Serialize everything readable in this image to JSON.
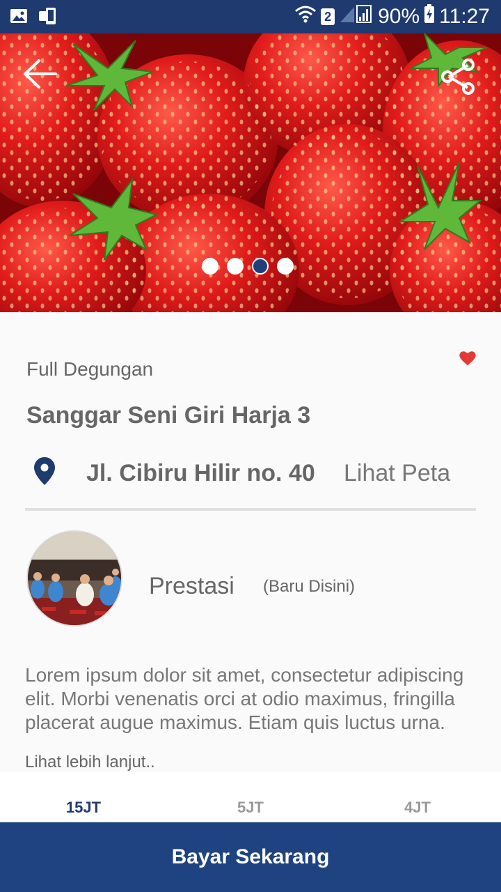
{
  "status_bar": {
    "sim_number": "2",
    "battery": "90%",
    "time": "11:27",
    "icons": [
      "gallery-icon",
      "device-icon",
      "wifi-icon",
      "signal-icon",
      "battery-icon"
    ]
  },
  "hero": {
    "slide_count": 4,
    "active_slide": 3
  },
  "detail": {
    "category": "Full Degungan",
    "title": "Sanggar Seni Giri Harja 3",
    "address": "Jl. Cibiru Hilir no. 40",
    "map_link": "Lihat Peta",
    "prestasi_label": "Prestasi",
    "prestasi_note": "(Baru Disini)",
    "description": "Lorem ipsum dolor sit amet, consectetur adipiscing elit. Morbi venenatis orci at odio maximus, fringilla placerat augue maximus. Etiam quis luctus urna.",
    "more_link": "Lihat lebih lanjut.."
  },
  "tabs": [
    {
      "label": "15JT",
      "active": true
    },
    {
      "label": "5JT",
      "active": false
    },
    {
      "label": "4JT",
      "active": false
    }
  ],
  "pay_button": "Bayar Sekarang",
  "colors": {
    "primary": "#1e3a6e",
    "accent_red": "#e53935",
    "text_gray": "#666666"
  }
}
